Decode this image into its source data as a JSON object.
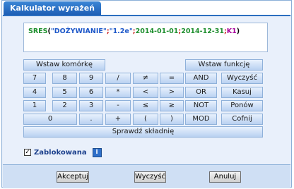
{
  "dialog": {
    "title": "Kalkulator wyrażeń"
  },
  "formula": {
    "fn": "SRES",
    "p1": "(",
    "s1": "\"DOŻYWIANIE\"",
    "sep1": ";",
    "s2": "\"1.2e\"",
    "sep2": ";",
    "d1": "2014-01-01",
    "sep3": ";",
    "d2": "2014-12-31",
    "sep4": ";",
    "cell": "K1",
    "p2": ")"
  },
  "buttons": {
    "insert_cell": "Wstaw komórkę",
    "insert_function": "Wstaw funkcję",
    "k7": "7",
    "k8": "8",
    "k9": "9",
    "div": "/",
    "neq": "≠",
    "eq": "=",
    "and": "AND",
    "clear": "Wyczyść",
    "k4": "4",
    "k5": "5",
    "k6": "6",
    "mul": "*",
    "lt": "<",
    "gt": ">",
    "or": "OR",
    "backspace": "Kasuj",
    "k1": "1",
    "k2": "2",
    "k3": "3",
    "minus": "-",
    "le": "≤",
    "ge": "≥",
    "not": "NOT",
    "redo": "Ponów",
    "k0": "0",
    "dot": ".",
    "plus": "+",
    "lparen": "(",
    "rparen": ")",
    "mod": "MOD",
    "undo": "Cofnij",
    "check_syntax": "Sprawdź składnię"
  },
  "lock": {
    "label": "Zablokowana",
    "checked": "✓",
    "info": "i"
  },
  "footer": {
    "accept": "Akceptuj",
    "clear": "Wyczyść",
    "cancel": "Anuluj"
  }
}
